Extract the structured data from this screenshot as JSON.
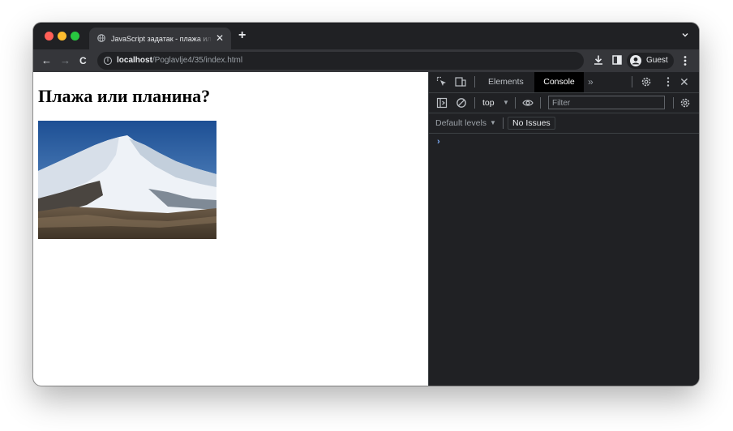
{
  "browser": {
    "tab": {
      "title": "JavaScript задатак - плажа или планина",
      "close_glyph": "✕"
    },
    "new_tab_glyph": "+",
    "toolbar": {
      "back_glyph": "←",
      "forward_glyph": "→",
      "reload_glyph": "C",
      "info_glyph": "i",
      "url_host": "localhost",
      "url_path": "/Poglavlje4/35/index.html",
      "profile_label": "Guest"
    },
    "icons": [
      "globe-icon",
      "chevron-down-icon",
      "back-arrow-icon",
      "forward-arrow-icon",
      "reload-icon",
      "info-icon",
      "download-icon",
      "side-panel-icon",
      "avatar-icon",
      "kebab-menu-icon"
    ],
    "colors": {
      "frame": "#202124",
      "toolbar": "#35363a",
      "close": "#ff5f57",
      "minimize": "#febc2e",
      "zoom": "#28c840"
    }
  },
  "page": {
    "heading": "Плажа или планина?",
    "image_alt": "mountain-photo",
    "background": "#ffffff"
  },
  "devtools": {
    "tabs": {
      "elements": "Elements",
      "console": "Console"
    },
    "more_glyph": "»",
    "close_glyph": "✕",
    "context": "top",
    "context_caret": "▼",
    "filter_placeholder": "Filter",
    "levels": "Default levels",
    "levels_caret": "▼",
    "issues": "No Issues",
    "prompt_glyph": "›",
    "icons": [
      "inspect-element-icon",
      "device-toolbar-icon",
      "settings-gear-icon",
      "devtools-kebab-icon",
      "sidebar-toggle-icon",
      "clear-console-icon",
      "eye-icon",
      "console-settings-icon"
    ],
    "colors": {
      "background": "#202124",
      "active_tab": "#000000",
      "prompt": "#7cacf8"
    }
  }
}
